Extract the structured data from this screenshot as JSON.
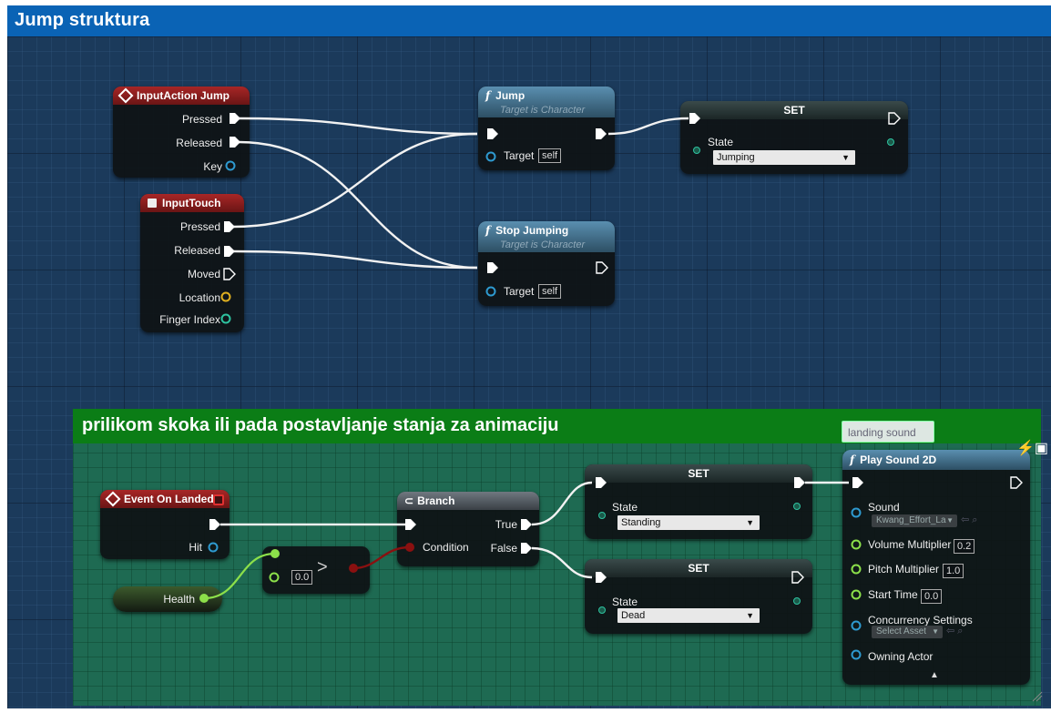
{
  "window": {
    "title": "Jump struktura"
  },
  "comment": {
    "title": "prilikom skoka ili pada postavljanje stanja za animaciju",
    "tooltip": "landing sound"
  },
  "nodes": {
    "input_action_jump": {
      "title": "InputAction Jump",
      "pins": {
        "pressed": "Pressed",
        "released": "Released",
        "key": "Key"
      }
    },
    "input_touch": {
      "title": "InputTouch",
      "pins": {
        "pressed": "Pressed",
        "released": "Released",
        "moved": "Moved",
        "location": "Location",
        "finger_index": "Finger Index"
      }
    },
    "jump": {
      "title": "Jump",
      "subtitle": "Target is Character",
      "target_label": "Target",
      "target_value": "self"
    },
    "stop_jumping": {
      "title": "Stop Jumping",
      "subtitle": "Target is Character",
      "target_label": "Target",
      "target_value": "self"
    },
    "set_jumping": {
      "title": "SET",
      "state_label": "State",
      "state_value": "Jumping"
    },
    "event_on_landed": {
      "title": "Event On Landed",
      "hit_label": "Hit"
    },
    "health": {
      "label": "Health"
    },
    "compare": {
      "value": "0.0"
    },
    "branch": {
      "title": "Branch",
      "condition": "Condition",
      "true_label": "True",
      "false_label": "False"
    },
    "set_standing": {
      "title": "SET",
      "state_label": "State",
      "state_value": "Standing"
    },
    "set_dead": {
      "title": "SET",
      "state_label": "State",
      "state_value": "Dead"
    },
    "play_sound": {
      "title": "Play Sound 2D",
      "sound_label": "Sound",
      "sound_asset": "Kwang_Effort_La",
      "volume_label": "Volume Multiplier",
      "volume_value": "0.2",
      "pitch_label": "Pitch Multiplier",
      "pitch_value": "1.0",
      "start_label": "Start Time",
      "start_value": "0.0",
      "concurrency_label": "Concurrency Settings",
      "concurrency_asset": "Select Asset",
      "owning_label": "Owning Actor"
    }
  },
  "colors": {
    "exec": "#ffffff",
    "bool": "#8a1010",
    "float": "#8ce04a",
    "object": "#2e9ad0",
    "struct": "#e0b020",
    "int": "#2ec3a0"
  }
}
